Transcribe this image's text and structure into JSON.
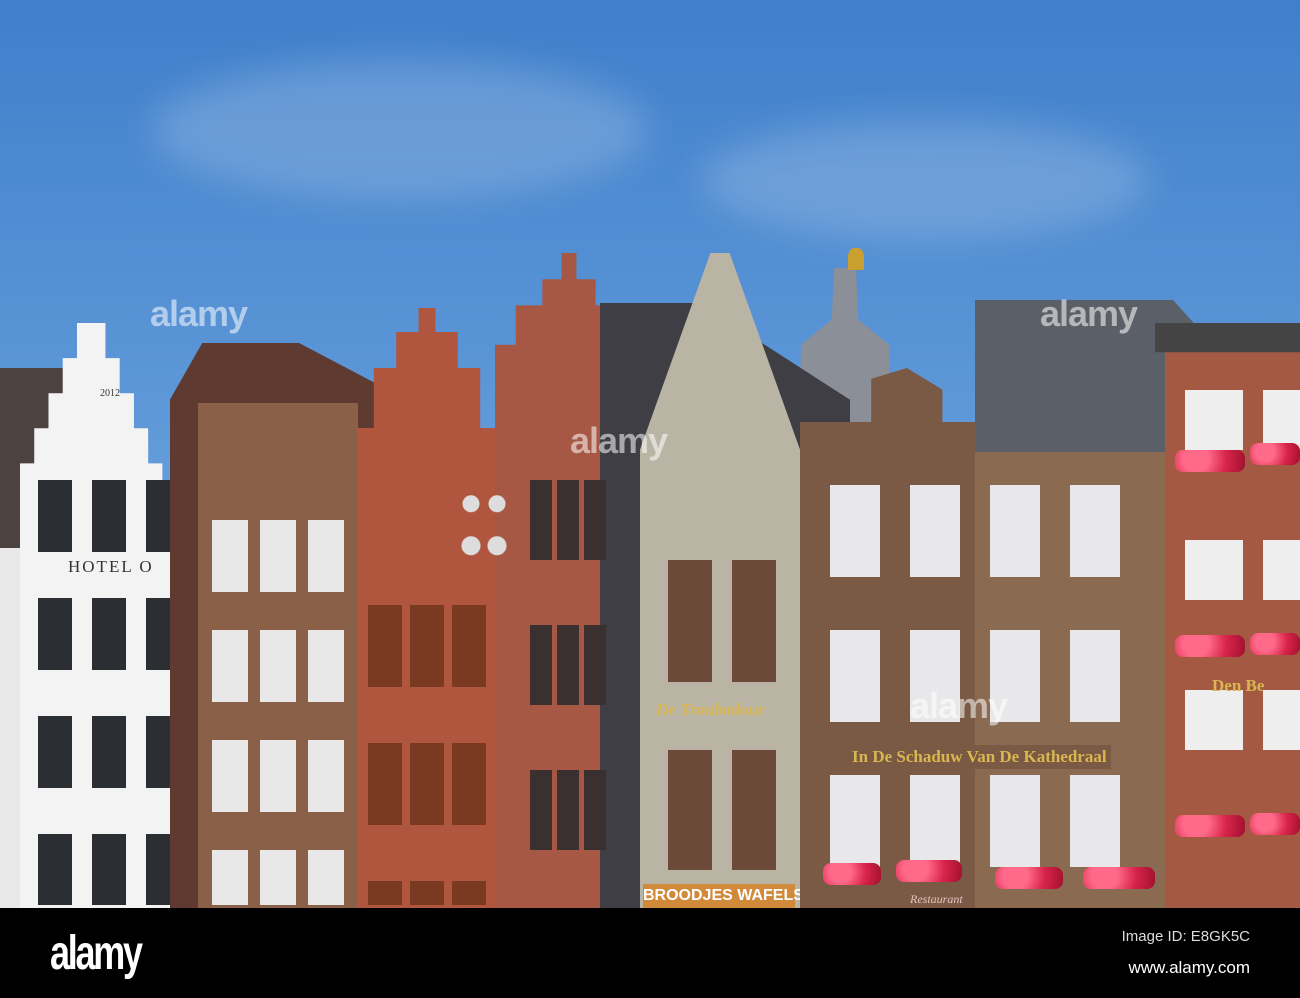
{
  "photo": {
    "hotel_sign": "HOTEL O",
    "hotel_year": "2012",
    "troubadour_sign": "De Troubadour",
    "schaduw_sign": "In De Schaduw Van De Kathedraal",
    "shop_sign": "BROODJES WAFELS",
    "right_sign": "Den Be",
    "restaurant_sign": "Restaurant",
    "watermark": "alamy"
  },
  "footer": {
    "logo": "alamy",
    "image_id": "Image ID: E8GK5C",
    "website": "www.alamy.com"
  },
  "colors": {
    "sky": "#4a8ad0",
    "brick_red": "#a4523c",
    "brick_brown": "#7a5a44",
    "stone": "#b9b4a3",
    "white_facade": "#f2f2f2",
    "sign_gold": "#d8b650"
  }
}
